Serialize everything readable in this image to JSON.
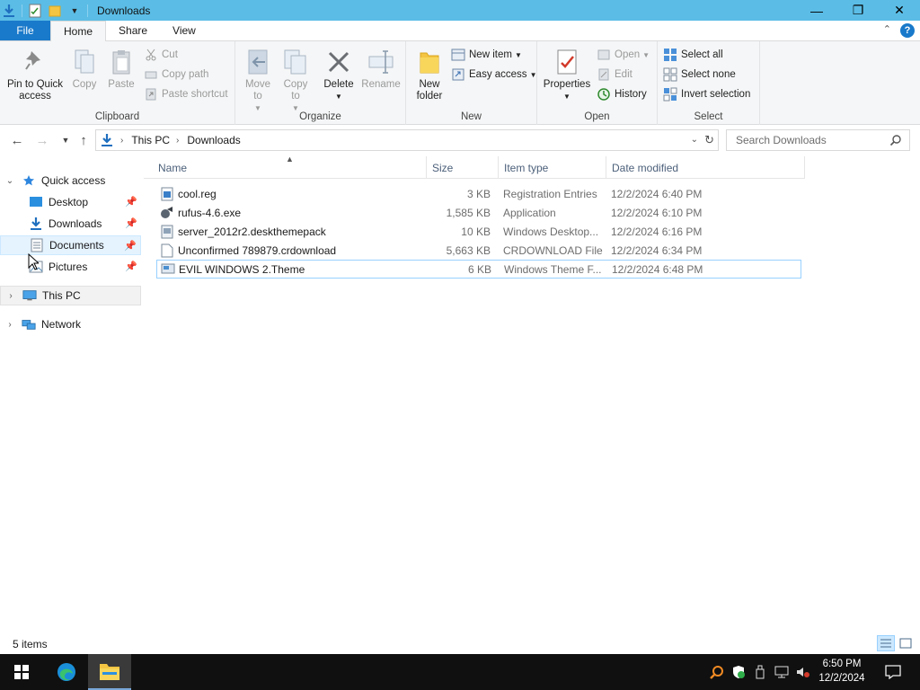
{
  "window": {
    "title": "Downloads",
    "minimize_glyph": "—",
    "maximize_glyph": "❐",
    "close_glyph": "✕"
  },
  "ribbon_tabs": {
    "file": "File",
    "home": "Home",
    "share": "Share",
    "view": "View"
  },
  "clipboard": {
    "pin": "Pin to Quick access",
    "copy": "Copy",
    "paste": "Paste",
    "cut": "Cut",
    "copy_path": "Copy path",
    "paste_shortcut": "Paste shortcut",
    "label": "Clipboard"
  },
  "organize": {
    "move_to": "Move to",
    "copy_to": "Copy to",
    "delete": "Delete",
    "rename": "Rename",
    "label": "Organize"
  },
  "new": {
    "new_folder": "New folder",
    "new_item": "New item",
    "easy_access": "Easy access",
    "label": "New"
  },
  "open": {
    "properties": "Properties",
    "open": "Open",
    "edit": "Edit",
    "history": "History",
    "label": "Open"
  },
  "select": {
    "select_all": "Select all",
    "select_none": "Select none",
    "invert_selection": "Invert selection",
    "label": "Select"
  },
  "address": {
    "crumbs": [
      "This PC",
      "Downloads"
    ],
    "search_placeholder": "Search Downloads"
  },
  "nav_pane": {
    "quick_access": "Quick access",
    "desktop": "Desktop",
    "downloads": "Downloads",
    "documents": "Documents",
    "pictures": "Pictures",
    "this_pc": "This PC",
    "network": "Network"
  },
  "columns": {
    "name": "Name",
    "size": "Size",
    "type": "Item type",
    "date": "Date modified"
  },
  "files": [
    {
      "name": "cool.reg",
      "size": "3 KB",
      "type": "Registration Entries",
      "date": "12/2/2024 6:40 PM",
      "icon": "registry-file-icon"
    },
    {
      "name": "rufus-4.6.exe",
      "size": "1,585 KB",
      "type": "Application",
      "date": "12/2/2024 6:10 PM",
      "icon": "application-exe-icon"
    },
    {
      "name": "server_2012r2.deskthemepack",
      "size": "10 KB",
      "type": "Windows Desktop...",
      "date": "12/2/2024 6:16 PM",
      "icon": "themepack-file-icon"
    },
    {
      "name": "Unconfirmed 789879.crdownload",
      "size": "5,663 KB",
      "type": "CRDOWNLOAD File",
      "date": "12/2/2024 6:34 PM",
      "icon": "generic-file-icon"
    },
    {
      "name": "EVIL WINDOWS 2.Theme",
      "size": "6 KB",
      "type": "Windows Theme F...",
      "date": "12/2/2024 6:48 PM",
      "icon": "theme-file-icon"
    }
  ],
  "status": {
    "items": "5 items"
  },
  "taskbar": {
    "time": "6:50 PM",
    "date": "12/2/2024"
  },
  "colors": {
    "titlebar": "#5bbde6",
    "file_tab": "#1979ca",
    "taskbar": "#101010",
    "selection_border": "#99d1ff"
  }
}
